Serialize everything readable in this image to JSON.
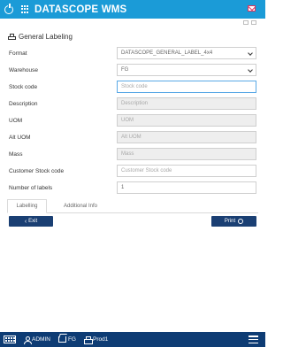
{
  "app": {
    "title": "DATASCOPE WMS"
  },
  "page": {
    "title": "General Labeling"
  },
  "form": {
    "format": {
      "label": "Format",
      "value": "DATASCOPE_GENERAL_LABEL_4x4"
    },
    "warehouse": {
      "label": "Warehouse",
      "value": "FG"
    },
    "stock_code": {
      "label": "Stock code",
      "placeholder": "Stock code"
    },
    "description": {
      "label": "Description",
      "placeholder": "Description"
    },
    "uom": {
      "label": "UOM",
      "placeholder": "UOM"
    },
    "alt_uom": {
      "label": "Alt UOM",
      "placeholder": "Alt UOM"
    },
    "mass": {
      "label": "Mass",
      "placeholder": "Mass"
    },
    "customer_stock_code": {
      "label": "Customer Stock code",
      "placeholder": "Customer Stock code"
    },
    "number_of_labels": {
      "label": "Number of labels",
      "value": "1"
    }
  },
  "tabs": [
    {
      "label": "Labelling",
      "active": true
    },
    {
      "label": "Additional Info",
      "active": false
    }
  ],
  "buttons": {
    "exit": "Exit",
    "print": "Print"
  },
  "footer": {
    "user": "ADMIN",
    "warehouse": "FG",
    "printer": "Prod1"
  },
  "colors": {
    "header": "#1b9bd7",
    "button": "#1a3f73",
    "footer": "#0e3c74",
    "mail": "#e0335b"
  }
}
